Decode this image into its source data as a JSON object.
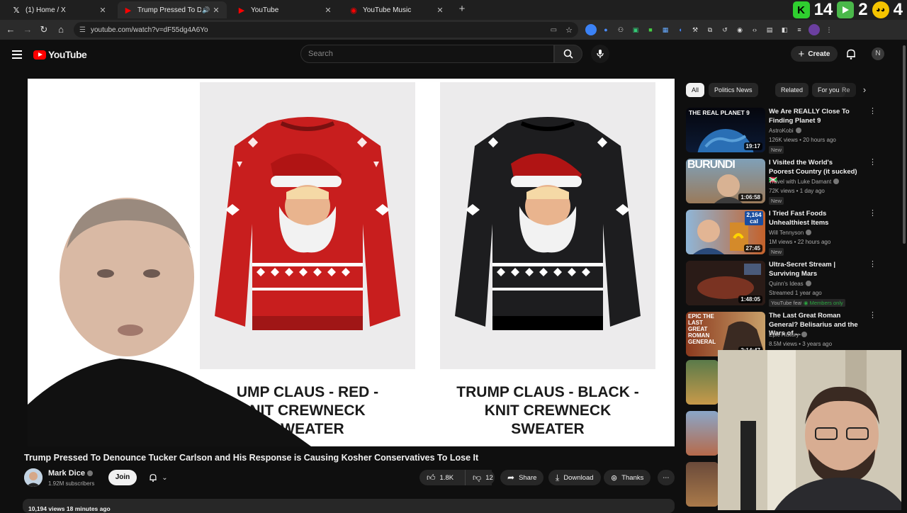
{
  "browser": {
    "tabs": [
      {
        "title": "(1) Home / X",
        "favicon": "x-logo-icon",
        "active": false
      },
      {
        "title": "Trump Pressed To Denounc",
        "favicon": "youtube-icon",
        "active": true
      },
      {
        "title": "YouTube",
        "favicon": "youtube-icon",
        "active": false
      },
      {
        "title": "YouTube Music",
        "favicon": "youtube-music-icon",
        "active": false
      }
    ],
    "url": "youtube.com/watch?v=dF55dg4A6Yo",
    "overlay": {
      "a": "14",
      "b": "2",
      "c": "4"
    }
  },
  "yt": {
    "logo_text": "YouTube",
    "search_placeholder": "Search",
    "create_label": "Create"
  },
  "player": {
    "caption_red": "TRUMP CLAUS - RED - KNIT CREWNECK SWEATER",
    "caption_red_visible": "UMP CLAUS - RED -\nNIT CREWNECK\nSWEATER",
    "caption_black": "TRUMP CLAUS - BLACK -\nKNIT CREWNECK\nSWEATER"
  },
  "video": {
    "title": "Trump Pressed To Denounce Tucker Carlson and His Response is Causing Kosher Conservatives To Lose It",
    "channel": "Mark Dice",
    "subscribers": "1.92M subscribers",
    "join_label": "Join",
    "likes": "1.8K",
    "dislikes": "12",
    "share_label": "Share",
    "download_label": "Download",
    "thanks_label": "Thanks",
    "views_line": "10,194 views  18 minutes ago"
  },
  "chips": [
    "All",
    "Politics News",
    "Related",
    "For you",
    "Re"
  ],
  "recommendations": [
    {
      "title": "We Are REALLY Close To Finding Planet 9",
      "channel": "AstroKobi",
      "meta": "126K views • 20 hours ago",
      "badge": "New",
      "duration": "19:17",
      "thumb_text": "THE REAL PLANET 9"
    },
    {
      "title": "I Visited the World's Poorest Country (it sucked) 🇧🇮",
      "channel": "Travel with Luke Damant",
      "meta": "72K views • 1 day ago",
      "badge": "New",
      "duration": "1:06:58",
      "thumb_text": "BURUNDI"
    },
    {
      "title": "I Tried Fast Foods Unhealthiest Items",
      "channel": "Will Tennyson",
      "meta": "1M views • 22 hours ago",
      "badge": "New",
      "duration": "27:45",
      "thumb_text": "2,164 cal"
    },
    {
      "title": "Ultra-Secret Stream | Surviving Mars",
      "channel": "Quinn's Ideas",
      "meta": "Streamed 1 year ago",
      "badge": "YouTube featured",
      "badge2": "Members only",
      "duration": "1:48:05",
      "thumb_text": ""
    },
    {
      "title": "The Last Great Roman General? Belisarius and the Wars of ...",
      "channel": "Epic History",
      "meta": "8.5M views • 3 years ago",
      "badge": "",
      "duration": "2:14:47",
      "thumb_text": "EPIC THE LAST GREAT ROMAN GENERAL"
    }
  ],
  "colors": {
    "bg": "#0f0f0f",
    "accent": "#ff0000",
    "chip": "#272727"
  }
}
